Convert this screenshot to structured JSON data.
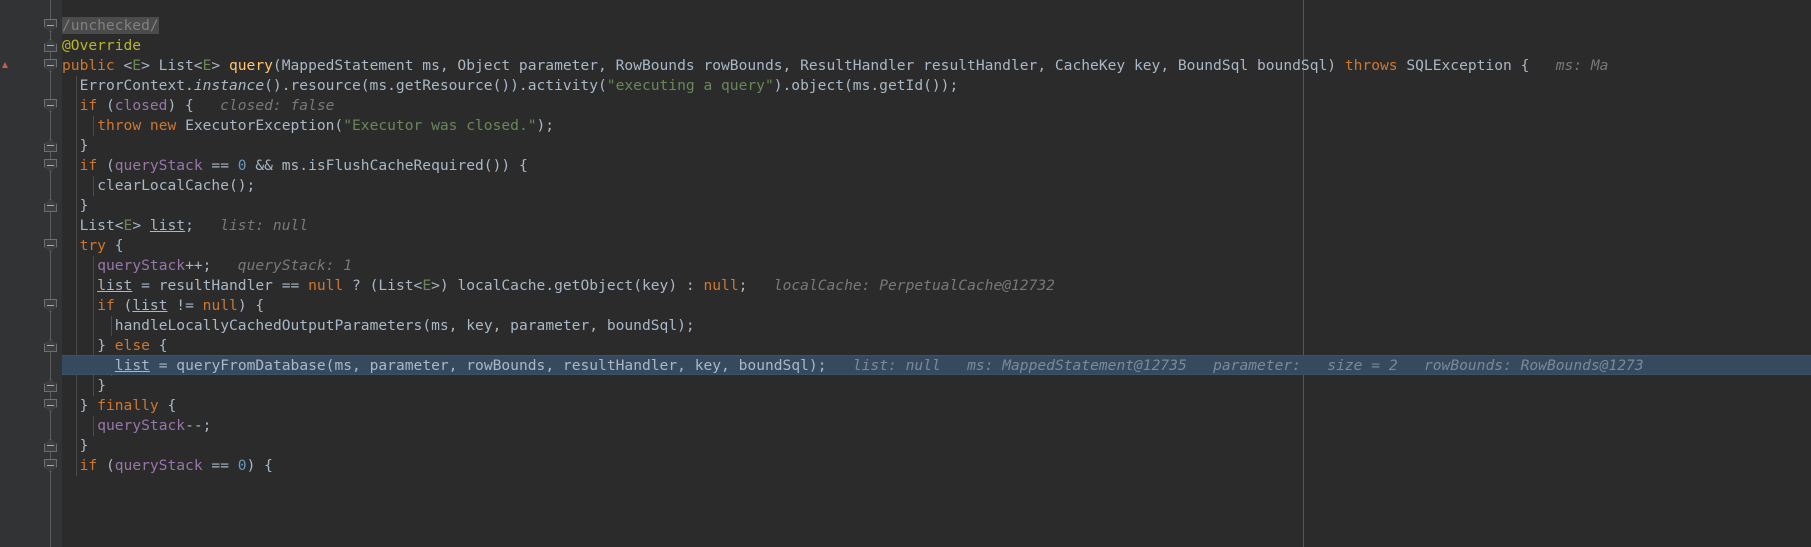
{
  "app": {
    "kind": "code-editor",
    "theme": "darcula",
    "background": "#2b2b2b",
    "gutter_background": "#313335",
    "highlight_line_background": "#354a5f",
    "margin_guide_x": 1241
  },
  "colors": {
    "keyword": "#cc7832",
    "field": "#9876aa",
    "method_declaration": "#ffc66d",
    "string": "#6a8759",
    "number": "#6897bb",
    "annotation": "#bbb529",
    "comment": "#808080",
    "inline_debug_hint": "#787878",
    "default_text": "#a9b7c6",
    "error_marker": "#cc5a54"
  },
  "editor": {
    "language": "java",
    "current_line_index": 17,
    "lines": [
      {
        "index": 0,
        "indent": 0,
        "fold": "collapse",
        "selection": "/unchecked/",
        "tokens": [
          {
            "t": "/unchecked/",
            "c": "cmt sel"
          }
        ]
      },
      {
        "index": 1,
        "indent": 0,
        "fold": "end",
        "tokens": [
          {
            "t": "@Override",
            "c": "anno"
          }
        ]
      },
      {
        "index": 2,
        "indent": 0,
        "fold": "collapse",
        "error_mark": true,
        "tokens": [
          {
            "t": "public",
            "c": "kw"
          },
          {
            "t": " <",
            "c": "cls"
          },
          {
            "t": "E",
            "c": "gen"
          },
          {
            "t": "> List<",
            "c": "cls"
          },
          {
            "t": "E",
            "c": "gen"
          },
          {
            "t": "> ",
            "c": "cls"
          },
          {
            "t": "query",
            "c": "def"
          },
          {
            "t": "(MappedStatement ms, Object parameter, RowBounds rowBounds, ResultHandler resultHandler, CacheKey key, BoundSql boundSql) ",
            "c": "cls"
          },
          {
            "t": "throws",
            "c": "kw"
          },
          {
            "t": " SQLException {",
            "c": "cls"
          },
          {
            "t": "   ms: Ma",
            "c": "hint"
          }
        ]
      },
      {
        "index": 3,
        "indent": 1,
        "tokens": [
          {
            "t": "ErrorContext.",
            "c": "cls"
          },
          {
            "t": "instance",
            "c": "cls ital"
          },
          {
            "t": "().resource(ms.getResource()).activity(",
            "c": "cls"
          },
          {
            "t": "\"executing a query\"",
            "c": "str"
          },
          {
            "t": ").object(ms.getId());",
            "c": "cls"
          }
        ]
      },
      {
        "index": 4,
        "indent": 1,
        "fold": "collapse",
        "tokens": [
          {
            "t": "if",
            "c": "kw"
          },
          {
            "t": " (",
            "c": "cls"
          },
          {
            "t": "closed",
            "c": "kw2"
          },
          {
            "t": ") {",
            "c": "cls"
          },
          {
            "t": "   closed: false",
            "c": "hint"
          }
        ]
      },
      {
        "index": 5,
        "indent": 2,
        "tokens": [
          {
            "t": "throw",
            "c": "kw"
          },
          {
            "t": " ",
            "c": "cls"
          },
          {
            "t": "new",
            "c": "kw"
          },
          {
            "t": " ExecutorException(",
            "c": "cls"
          },
          {
            "t": "\"Executor was closed.\"",
            "c": "str"
          },
          {
            "t": ");",
            "c": "cls"
          }
        ]
      },
      {
        "index": 6,
        "indent": 1,
        "fold": "end",
        "tokens": [
          {
            "t": "}",
            "c": "cls"
          }
        ]
      },
      {
        "index": 7,
        "indent": 1,
        "fold": "collapse",
        "tokens": [
          {
            "t": "if",
            "c": "kw"
          },
          {
            "t": " (",
            "c": "cls"
          },
          {
            "t": "queryStack",
            "c": "kw2"
          },
          {
            "t": " == ",
            "c": "cls"
          },
          {
            "t": "0",
            "c": "num"
          },
          {
            "t": " && ms.isFlushCacheRequired()) {",
            "c": "cls"
          }
        ]
      },
      {
        "index": 8,
        "indent": 2,
        "tokens": [
          {
            "t": "clearLocalCache();",
            "c": "cls"
          }
        ]
      },
      {
        "index": 9,
        "indent": 1,
        "fold": "end",
        "tokens": [
          {
            "t": "}",
            "c": "cls"
          }
        ]
      },
      {
        "index": 10,
        "indent": 1,
        "tokens": [
          {
            "t": "List<",
            "c": "cls"
          },
          {
            "t": "E",
            "c": "gen"
          },
          {
            "t": "> ",
            "c": "cls"
          },
          {
            "t": "list",
            "c": "cls uline"
          },
          {
            "t": ";",
            "c": "cls"
          },
          {
            "t": "   list: null",
            "c": "hint"
          }
        ]
      },
      {
        "index": 11,
        "indent": 1,
        "fold": "collapse",
        "tokens": [
          {
            "t": "try",
            "c": "kw"
          },
          {
            "t": " {",
            "c": "cls"
          }
        ]
      },
      {
        "index": 12,
        "indent": 2,
        "tokens": [
          {
            "t": "queryStack",
            "c": "kw2"
          },
          {
            "t": "++;",
            "c": "cls"
          },
          {
            "t": "   queryStack: 1",
            "c": "hint"
          }
        ]
      },
      {
        "index": 13,
        "indent": 2,
        "tokens": [
          {
            "t": "list",
            "c": "cls uline"
          },
          {
            "t": " = resultHandler == ",
            "c": "cls"
          },
          {
            "t": "null",
            "c": "kw"
          },
          {
            "t": " ? (List<",
            "c": "cls"
          },
          {
            "t": "E",
            "c": "gen"
          },
          {
            "t": ">) localCache.getObject(key) : ",
            "c": "cls"
          },
          {
            "t": "null",
            "c": "kw"
          },
          {
            "t": ";",
            "c": "cls"
          },
          {
            "t": "   localCache: PerpetualCache@12732",
            "c": "hint"
          }
        ]
      },
      {
        "index": 14,
        "indent": 2,
        "fold": "collapse",
        "tokens": [
          {
            "t": "if",
            "c": "kw"
          },
          {
            "t": " (",
            "c": "cls"
          },
          {
            "t": "list",
            "c": "cls uline"
          },
          {
            "t": " != ",
            "c": "cls"
          },
          {
            "t": "null",
            "c": "kw"
          },
          {
            "t": ") {",
            "c": "cls"
          }
        ]
      },
      {
        "index": 15,
        "indent": 3,
        "tokens": [
          {
            "t": "handleLocallyCachedOutputParameters(ms, key, parameter, boundSql);",
            "c": "cls"
          }
        ]
      },
      {
        "index": 16,
        "indent": 2,
        "fold": "end",
        "tokens": [
          {
            "t": "} ",
            "c": "cls"
          },
          {
            "t": "else",
            "c": "kw"
          },
          {
            "t": " {",
            "c": "cls"
          }
        ]
      },
      {
        "index": 17,
        "indent": 3,
        "current": true,
        "tokens": [
          {
            "t": "list",
            "c": "cls uline"
          },
          {
            "t": " = queryFromDatabase(ms, parameter, rowBounds, resultHandler, key, boundSql);",
            "c": "cls"
          },
          {
            "t": "   list: null   ms: MappedStatement@12735   parameter:   size = 2   rowBounds: RowBounds@1273",
            "c": "hint"
          }
        ]
      },
      {
        "index": 18,
        "indent": 2,
        "fold": "end",
        "tokens": [
          {
            "t": "}",
            "c": "cls"
          }
        ]
      },
      {
        "index": 19,
        "indent": 1,
        "fold": "collapse",
        "tokens": [
          {
            "t": "} ",
            "c": "cls"
          },
          {
            "t": "finally",
            "c": "kw"
          },
          {
            "t": " {",
            "c": "cls"
          }
        ]
      },
      {
        "index": 20,
        "indent": 2,
        "tokens": [
          {
            "t": "queryStack",
            "c": "kw2"
          },
          {
            "t": "--;",
            "c": "cls"
          }
        ]
      },
      {
        "index": 21,
        "indent": 1,
        "fold": "end",
        "tokens": [
          {
            "t": "}",
            "c": "cls"
          }
        ]
      },
      {
        "index": 22,
        "indent": 1,
        "fold": "collapse",
        "tokens": [
          {
            "t": "if",
            "c": "kw"
          },
          {
            "t": " (",
            "c": "cls"
          },
          {
            "t": "queryStack",
            "c": "kw2"
          },
          {
            "t": " == ",
            "c": "cls"
          },
          {
            "t": "0",
            "c": "num"
          },
          {
            "t": ") {",
            "c": "cls"
          }
        ]
      }
    ]
  }
}
